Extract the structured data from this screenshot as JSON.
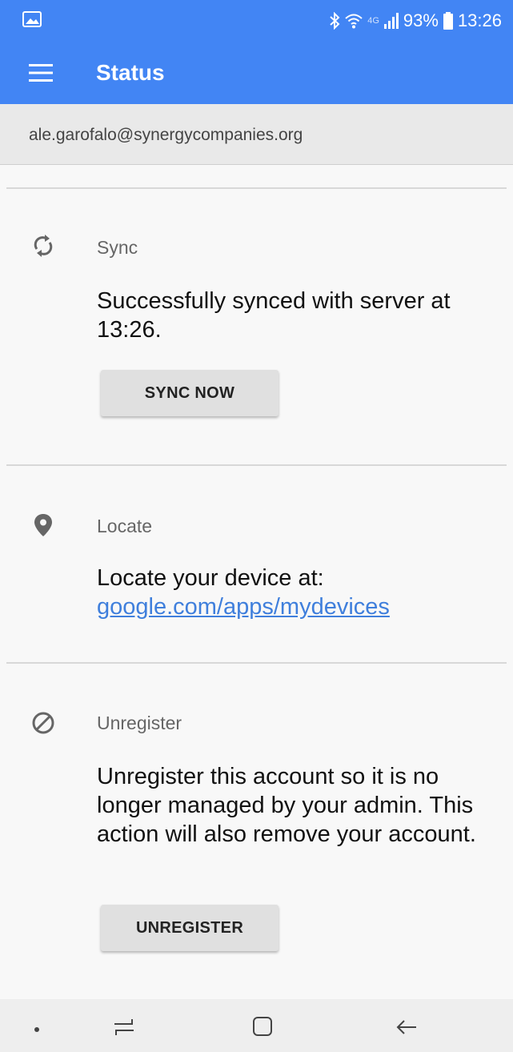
{
  "status_bar": {
    "icons": [
      "image-icon",
      "bluetooth-icon",
      "wifi-icon",
      "lte-icon",
      "signal-icon",
      "battery-icon"
    ],
    "network_type": "4G",
    "battery": "93%",
    "time": "13:26"
  },
  "app_bar": {
    "title": "Status",
    "menu_icon": "hamburger-menu-icon",
    "color": "#4285f4"
  },
  "account": {
    "email": "ale.garofalo@synergycompanies.org"
  },
  "sync": {
    "icon": "sync-icon",
    "label": "Sync",
    "text": "Successfully synced with server at 13:26.",
    "button": "SYNC NOW"
  },
  "locate": {
    "icon": "location-pin-icon",
    "label": "Locate",
    "text": "Locate your device at: ",
    "link": "google.com/apps/mydevices",
    "link_color": "#3f7fdc"
  },
  "unregister": {
    "icon": "block-icon",
    "label": "Unregister",
    "text": "Unregister this account so it is no longer managed by your admin. This action will also remove your account.",
    "button": "UNREGISTER"
  },
  "nav_bar": {
    "items": [
      "dot-icon",
      "recents-icon",
      "home-icon",
      "back-icon"
    ]
  }
}
